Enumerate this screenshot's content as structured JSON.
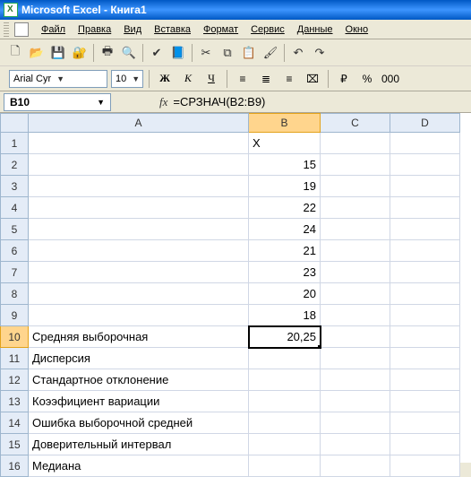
{
  "title": "Microsoft Excel - Книга1",
  "menu": {
    "file": "Файл",
    "edit": "Правка",
    "view": "Вид",
    "insert": "Вставка",
    "format": "Формат",
    "tools": "Сервис",
    "data": "Данные",
    "window": "Окно"
  },
  "format": {
    "font_name": "Arial Cyr",
    "font_size": "10",
    "bold": "Ж",
    "italic": "К",
    "underline": "Ч"
  },
  "namebox": "B10",
  "fx": "fx",
  "formula": "=СРЗНАЧ(B2:B9)",
  "columns": {
    "A": "A",
    "B": "B",
    "C": "C",
    "D": "D"
  },
  "rows": {
    "1": {
      "n": "1",
      "A": "",
      "B": "X",
      "B_align": "l"
    },
    "2": {
      "n": "2",
      "A": "",
      "B": "15"
    },
    "3": {
      "n": "3",
      "A": "",
      "B": "19"
    },
    "4": {
      "n": "4",
      "A": "",
      "B": "22"
    },
    "5": {
      "n": "5",
      "A": "",
      "B": "24"
    },
    "6": {
      "n": "6",
      "A": "",
      "B": "21"
    },
    "7": {
      "n": "7",
      "A": "",
      "B": "23"
    },
    "8": {
      "n": "8",
      "A": "",
      "B": "20"
    },
    "9": {
      "n": "9",
      "A": "",
      "B": "18"
    },
    "10": {
      "n": "10",
      "A": "Средняя выборочная",
      "B": "20,25"
    },
    "11": {
      "n": "11",
      "A": "Дисперсия",
      "B": ""
    },
    "12": {
      "n": "12",
      "A": "Стандартное отклонение",
      "B": ""
    },
    "13": {
      "n": "13",
      "A": "Коээфициент вариации",
      "B": ""
    },
    "14": {
      "n": "14",
      "A": "Ошибка выборочной средней",
      "B": ""
    },
    "15": {
      "n": "15",
      "A": "Доверительный интервал",
      "B": ""
    },
    "16": {
      "n": "16",
      "A": "Медиана",
      "B": ""
    }
  },
  "icons": {
    "new": "🗋",
    "open": "📂",
    "save": "💾",
    "perm": "🔐",
    "print": "🖶",
    "preview": "🔍",
    "spell": "✔",
    "research": "📘",
    "cut": "✂",
    "copy": "⧉",
    "paste": "📋",
    "fmtpaint": "🖌",
    "undo": "↶",
    "redo": "↷",
    "alignL": "≡",
    "alignC": "≣",
    "alignR": "≡",
    "merge": "⌧",
    "currency": "₽",
    "percent": "%",
    "comma": "000"
  }
}
